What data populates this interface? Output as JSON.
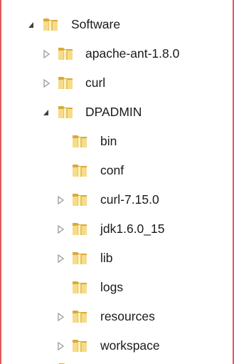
{
  "tree": {
    "root": {
      "label": "Software",
      "state": "expanded",
      "icon": "folder-icon"
    },
    "items": [
      {
        "label": "apache-ant-1.8.0",
        "state": "collapsed",
        "icon": "folder-icon"
      },
      {
        "label": "curl",
        "state": "collapsed",
        "icon": "folder-icon"
      },
      {
        "label": "DPADMIN",
        "state": "expanded",
        "icon": "folder-icon"
      }
    ],
    "dpadmin_children": [
      {
        "label": "bin",
        "state": "leaf",
        "icon": "folder-icon"
      },
      {
        "label": "conf",
        "state": "leaf",
        "icon": "folder-icon"
      },
      {
        "label": "curl-7.15.0",
        "state": "collapsed",
        "icon": "folder-icon"
      },
      {
        "label": "jdk1.6.0_15",
        "state": "collapsed",
        "icon": "folder-icon"
      },
      {
        "label": "lib",
        "state": "collapsed",
        "icon": "folder-icon"
      },
      {
        "label": "logs",
        "state": "leaf",
        "icon": "folder-icon"
      },
      {
        "label": "resources",
        "state": "collapsed",
        "icon": "folder-icon"
      },
      {
        "label": "workspace",
        "state": "collapsed",
        "icon": "folder-icon"
      }
    ]
  },
  "colors": {
    "frame_border": "#e05b5b",
    "folder_light": "#f6dc8a",
    "folder_dark": "#d9a93b",
    "expander_open": "#404040",
    "expander_closed": "#9a9a9a"
  }
}
